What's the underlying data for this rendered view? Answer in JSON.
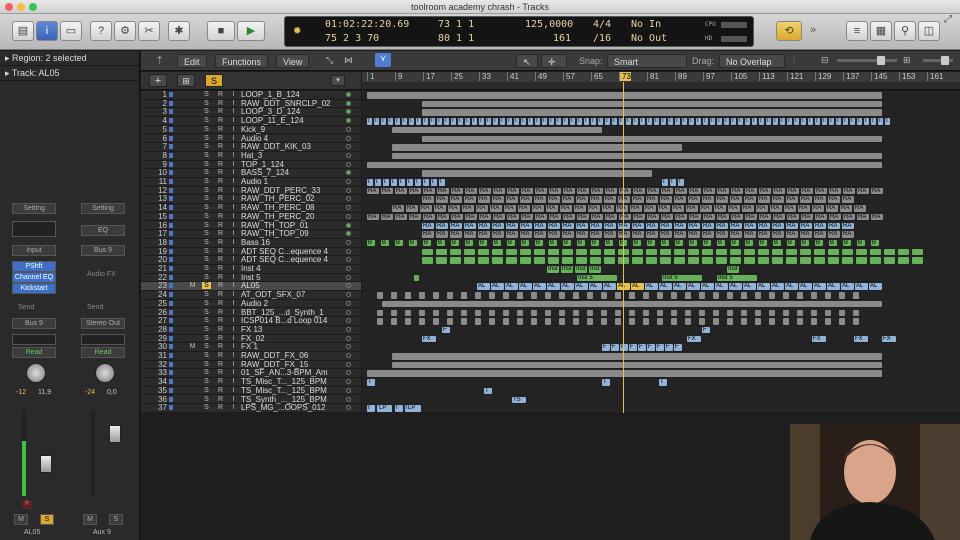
{
  "window": {
    "title": "toolroom academy chrash - Tracks"
  },
  "lcd": {
    "position": "01:02:22:20.69",
    "bars": "73  1  1",
    "tempo": "125,0000",
    "signature": "4/4",
    "key_in": "No In",
    "position2": "75  2  3   70",
    "bars2": "80  1  1",
    "bars_num": "161",
    "division": "/16",
    "key_out": "No Out",
    "cpu_label": "CPU",
    "hd_label": "HD"
  },
  "inspector": {
    "region": "Region: 2 selected",
    "track": "Track:  AL05",
    "strip1": {
      "setting": "Setting",
      "input": "Input",
      "plugins": [
        "PShft",
        "Channel EQ",
        "Kickstart"
      ],
      "send": "Send",
      "output": "Bus 9",
      "automation": "Read",
      "pan": "-12",
      "vol": "11,9",
      "rec": "R",
      "m": "M",
      "s": "S",
      "name": "AL05"
    },
    "strip2": {
      "setting": "Setting",
      "eq": "EQ",
      "input": "Bus 9",
      "audio_fx": "Audio FX",
      "send": "Send",
      "output": "Stereo Out",
      "automation": "Read",
      "pan": "-24",
      "vol": "0,0",
      "m": "M",
      "s": "S",
      "name": "Aux 9"
    }
  },
  "editor": {
    "menus": [
      "Edit",
      "Functions",
      "View"
    ],
    "snap_label": "Snap:",
    "snap_value": "Smart",
    "drag_label": "Drag:",
    "drag_value": "No Overlap",
    "ruler": [
      "1",
      "9",
      "17",
      "25",
      "33",
      "41",
      "49",
      "57",
      "65",
      "73",
      "81",
      "89",
      "97",
      "105",
      "113",
      "121",
      "129",
      "137",
      "145",
      "153",
      "161"
    ],
    "playhead_bar": "73"
  },
  "tracks": [
    {
      "n": "1",
      "name": "LOOP_1_B_124"
    },
    {
      "n": "2",
      "name": "RAW_DDT_SNRCLP_02"
    },
    {
      "n": "3",
      "name": "LOOP_3_D_124"
    },
    {
      "n": "4",
      "name": "LOOP_11_E_124"
    },
    {
      "n": "5",
      "name": "Kick_9"
    },
    {
      "n": "6",
      "name": "Audio 4"
    },
    {
      "n": "7",
      "name": "RAW_DDT_KIK_03"
    },
    {
      "n": "8",
      "name": "Hat_3"
    },
    {
      "n": "9",
      "name": "TOP_1_124"
    },
    {
      "n": "10",
      "name": "BASS_7_124"
    },
    {
      "n": "11",
      "name": "Audio 1"
    },
    {
      "n": "12",
      "name": "RAW_DDT_PERC_33"
    },
    {
      "n": "13",
      "name": "RAW_TH_PERC_02"
    },
    {
      "n": "14",
      "name": "RAW_TH_PERC_08"
    },
    {
      "n": "15",
      "name": "RAW_TH_PERC_20"
    },
    {
      "n": "16",
      "name": "RAW_TH_TOP_01"
    },
    {
      "n": "17",
      "name": "RAW_TH_TOP_09"
    },
    {
      "n": "18",
      "name": "Bass 16"
    },
    {
      "n": "19",
      "name": "ADT SEQ C...equence 4"
    },
    {
      "n": "20",
      "name": "ADT SEQ C...equence 4"
    },
    {
      "n": "21",
      "name": "Inst 4"
    },
    {
      "n": "22",
      "name": "Inst 5"
    },
    {
      "n": "23",
      "name": "AL05"
    },
    {
      "n": "24",
      "name": "AT_ODT_SFX_07"
    },
    {
      "n": "25",
      "name": "Audio 2"
    },
    {
      "n": "26",
      "name": "BBT_125_...d_Synth_1"
    },
    {
      "n": "27",
      "name": "ICSP014 B...d Loop 014"
    },
    {
      "n": "28",
      "name": "FX 13"
    },
    {
      "n": "29",
      "name": "FX_02"
    },
    {
      "n": "30",
      "name": "FX 1"
    },
    {
      "n": "31",
      "name": "RAW_DDT_FX_06"
    },
    {
      "n": "32",
      "name": "RAW_DDT_FX_15"
    },
    {
      "n": "33",
      "name": "01_SF_AN...3-BPM_Am"
    },
    {
      "n": "34",
      "name": "TS_Misc_T..._125_BPM"
    },
    {
      "n": "35",
      "name": "TS_Misc_T..._125_BPM"
    },
    {
      "n": "36",
      "name": "TS_Synth_..._125_BPM"
    },
    {
      "n": "37",
      "name": "LPS_MG_...OOPS_012"
    }
  ],
  "region_labels": {
    "ra": "RA",
    "b": "B",
    "inst4": "Inst",
    "inst5": "Inst 5",
    "al": "AL",
    "f": "F",
    "fx": "FX",
    "t": "T",
    "ts": "TS",
    "lp": "LP",
    "i": "I"
  },
  "colors": {
    "audio": "#8a8a8a",
    "blue": "#8fb3d9",
    "green": "#66b15a",
    "yellow": "#e8c14a",
    "playhead": "#e8c14a"
  }
}
